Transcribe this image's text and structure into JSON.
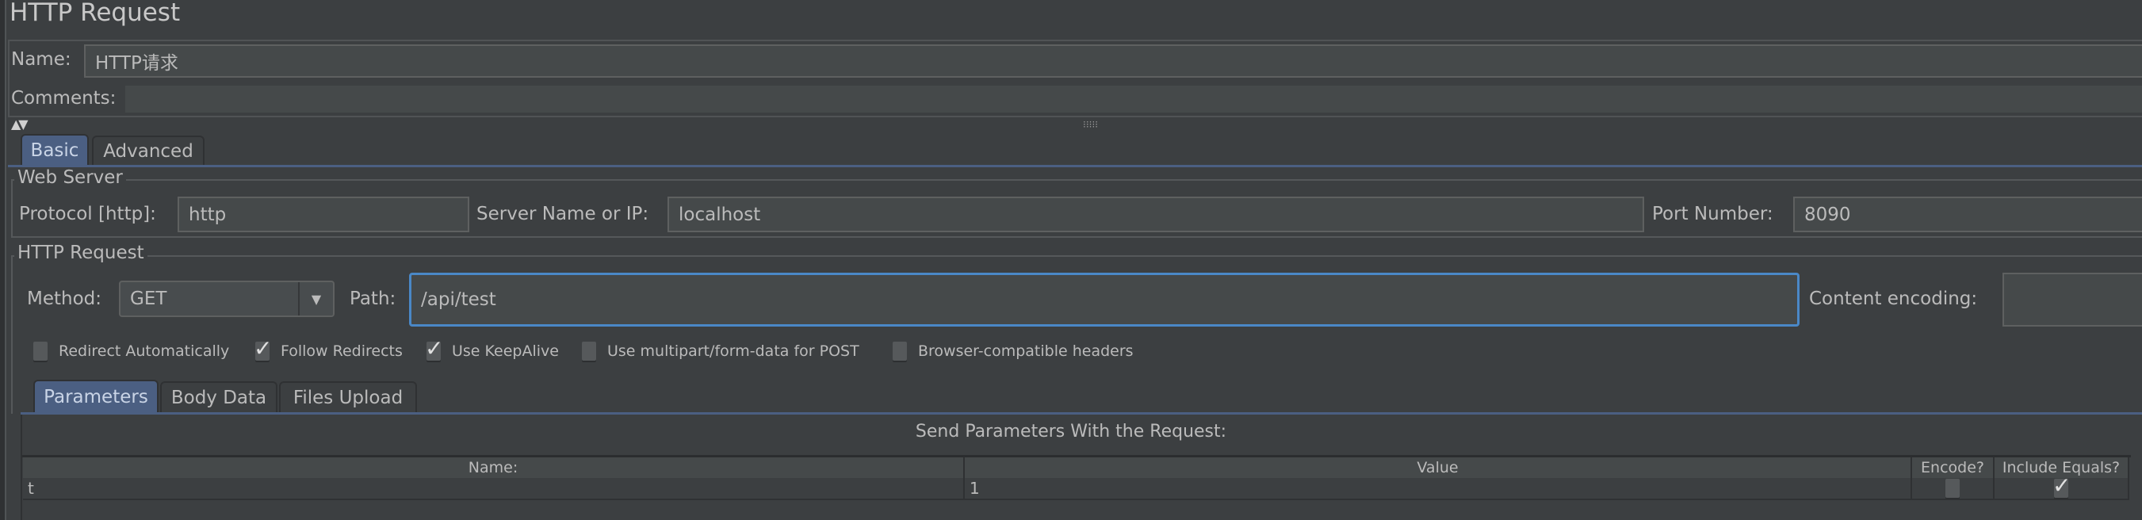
{
  "title": "HTTP Request",
  "name": {
    "label": "Name:",
    "value": "HTTP请求"
  },
  "comments": {
    "label": "Comments:",
    "value": ""
  },
  "main_tabs": [
    {
      "label": "Basic",
      "selected": true
    },
    {
      "label": "Advanced",
      "selected": false
    }
  ],
  "web_server": {
    "legend": "Web Server",
    "protocol_label": "Protocol [http]:",
    "protocol_value": "http",
    "server_label": "Server Name or IP:",
    "server_value": "localhost",
    "port_label": "Port Number:",
    "port_value": "8090"
  },
  "http_request": {
    "legend": "HTTP Request",
    "method_label": "Method:",
    "method_value": "GET",
    "path_label": "Path:",
    "path_value": "/api/test",
    "encoding_label": "Content encoding:",
    "encoding_value": ""
  },
  "options": [
    {
      "label": "Redirect Automatically",
      "checked": false
    },
    {
      "label": "Follow Redirects",
      "checked": true
    },
    {
      "label": "Use KeepAlive",
      "checked": true
    },
    {
      "label": "Use multipart/form-data for POST",
      "checked": false
    },
    {
      "label": "Browser-compatible headers",
      "checked": false
    }
  ],
  "param_tabs": [
    {
      "label": "Parameters",
      "selected": true
    },
    {
      "label": "Body Data",
      "selected": false
    },
    {
      "label": "Files Upload",
      "selected": false
    }
  ],
  "params": {
    "caption": "Send Parameters With the Request:",
    "columns": [
      "Name:",
      "Value",
      "Encode?",
      "Include Equals?"
    ],
    "rows": [
      {
        "name": "t",
        "value": "1",
        "encode": false,
        "include_equals": true
      }
    ]
  },
  "colors": {
    "background": "#3c3f41",
    "field": "#45494a",
    "selected_tab": "#4b5f82",
    "focus": "#4a88c7"
  }
}
